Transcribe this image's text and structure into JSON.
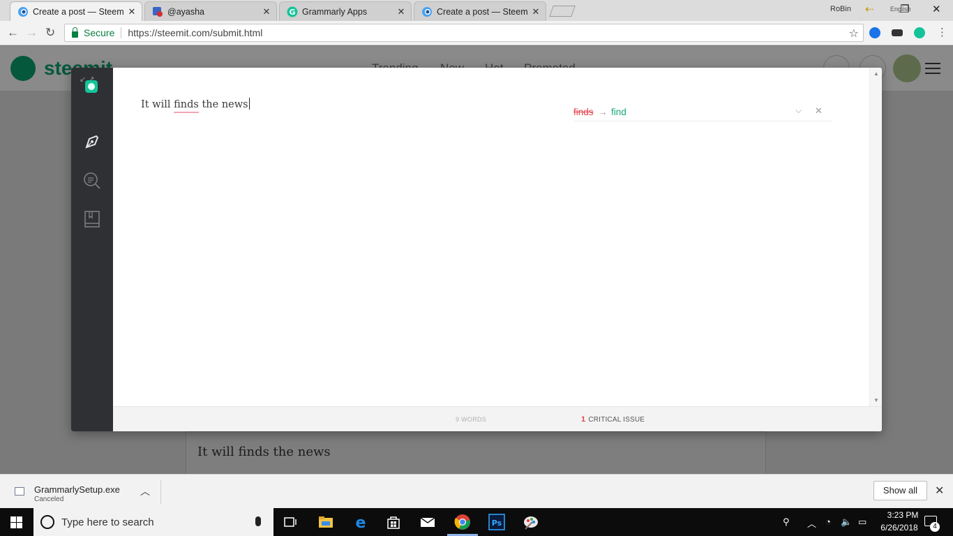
{
  "browser": {
    "tabs": [
      {
        "title": "Create a post — Steemit",
        "active": true
      },
      {
        "title": "@ayasha",
        "active": false
      },
      {
        "title": "Grammarly Apps",
        "active": false
      },
      {
        "title": "Create a post — Steemit",
        "active": false
      }
    ],
    "tab_close_glyph": "✕",
    "profile_name": "RoBin",
    "tray_language_label": "English",
    "secure_label": "Secure",
    "url": "https://steemit.com/submit.html"
  },
  "steemit_page": {
    "logo_text": "steemit",
    "nav": [
      "Trending",
      "New",
      "Hot",
      "Promoted"
    ],
    "editor_text": "It will finds the news",
    "brand_color": "#06583d"
  },
  "grammarly": {
    "document": {
      "words": [
        "It",
        "will",
        "finds",
        "the",
        "news"
      ],
      "flagged_word": "finds"
    },
    "suggestion": {
      "original": "finds",
      "arrow": "→",
      "replacement": "find"
    },
    "footer": {
      "word_count": "9 WORDS",
      "critical_count": "1",
      "critical_label": "CRITICAL ISSUE"
    },
    "colors": {
      "accent": "#15c39a",
      "error": "#e2424b",
      "sidebar": "#2e3033"
    }
  },
  "downloads": {
    "file_name": "GrammarlySetup.exe",
    "status": "Canceled",
    "show_all": "Show all"
  },
  "taskbar": {
    "search_placeholder": "Type here to search",
    "time": "3:23 PM",
    "date": "6/26/2018",
    "notification_count": "4",
    "apps": [
      "task-view",
      "file-explorer",
      "edge",
      "store",
      "mail",
      "chrome",
      "photoshop",
      "paint"
    ]
  }
}
